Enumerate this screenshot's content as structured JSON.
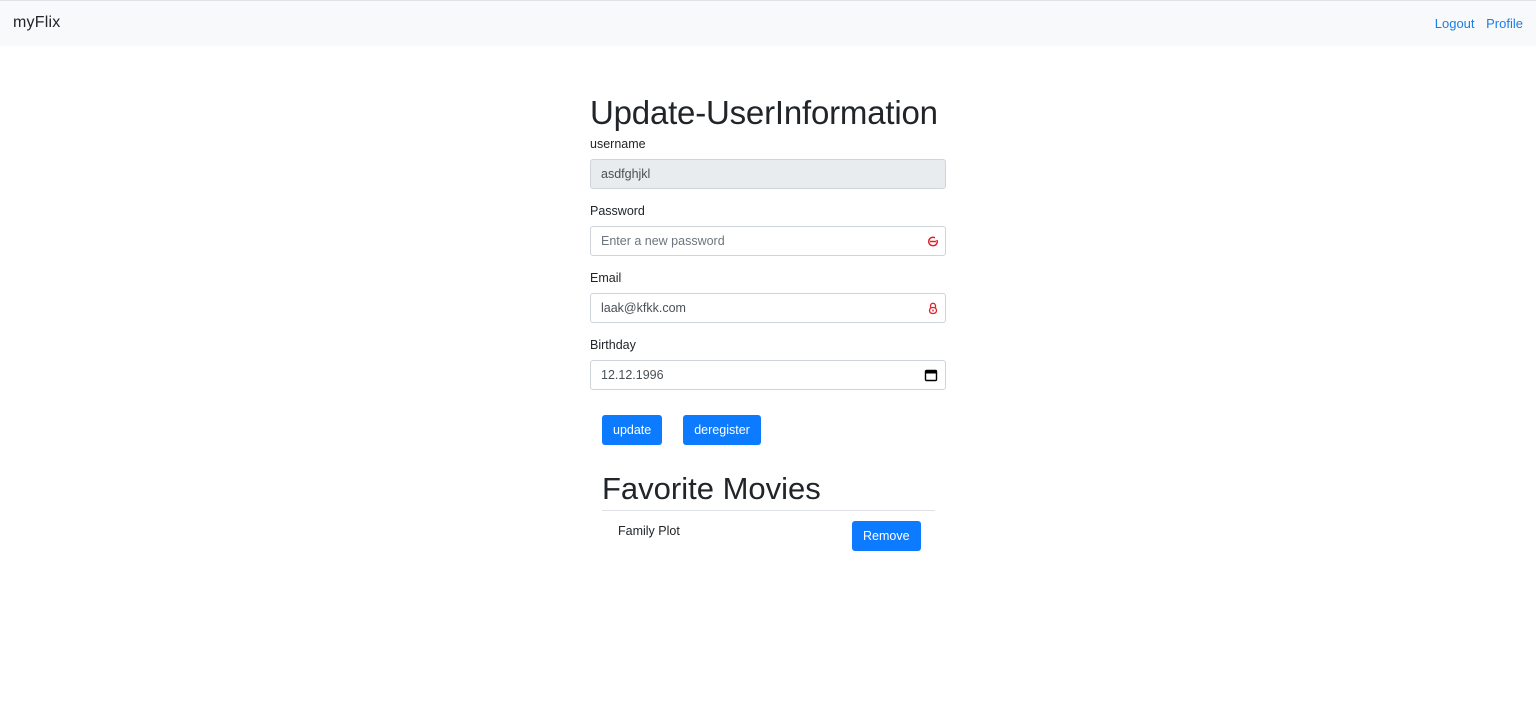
{
  "navbar": {
    "brand": "myFlix",
    "links": [
      {
        "label": "Logout"
      },
      {
        "label": "Profile"
      }
    ],
    "link_color": "#1a7fe6"
  },
  "form": {
    "title": "Update-UserInformation",
    "username": {
      "label": "username",
      "value": "asdfghjkl"
    },
    "password": {
      "label": "Password",
      "placeholder": "Enter a new password",
      "value": ""
    },
    "email": {
      "label": "Email",
      "value": "laak@kfkk.com"
    },
    "birthday": {
      "label": "Birthday",
      "value": "12.12.1996"
    },
    "update_label": "update",
    "deregister_label": "deregister"
  },
  "favorites": {
    "title": "Favorite Movies",
    "movies": [
      {
        "title": "Family Plot",
        "remove_label": "Remove"
      }
    ]
  },
  "colors": {
    "primary": "#0d7bff",
    "navbar_bg": "#f8f9fa",
    "readonly_bg": "#e9ecef",
    "password_icon": "#e0202a"
  }
}
